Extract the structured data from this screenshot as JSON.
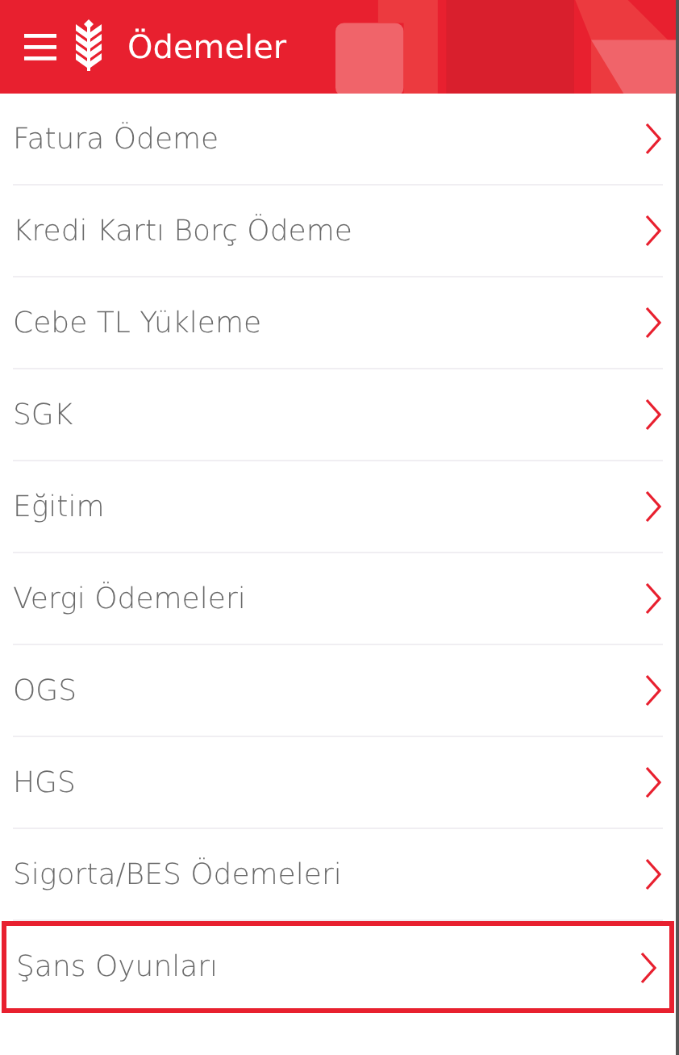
{
  "header": {
    "title": "Ödemeler"
  },
  "items": [
    {
      "label": "Fatura Ödeme",
      "selected": false
    },
    {
      "label": "Kredi Kartı Borç Ödeme",
      "selected": false
    },
    {
      "label": "Cebe TL Yükleme",
      "selected": false
    },
    {
      "label": "SGK",
      "selected": false
    },
    {
      "label": "Eğitim",
      "selected": false
    },
    {
      "label": "Vergi Ödemeleri",
      "selected": false
    },
    {
      "label": "OGS",
      "selected": false
    },
    {
      "label": "HGS",
      "selected": false
    },
    {
      "label": "Sigorta/BES Ödemeleri",
      "selected": false
    },
    {
      "label": "Şans Oyunları",
      "selected": true
    }
  ]
}
